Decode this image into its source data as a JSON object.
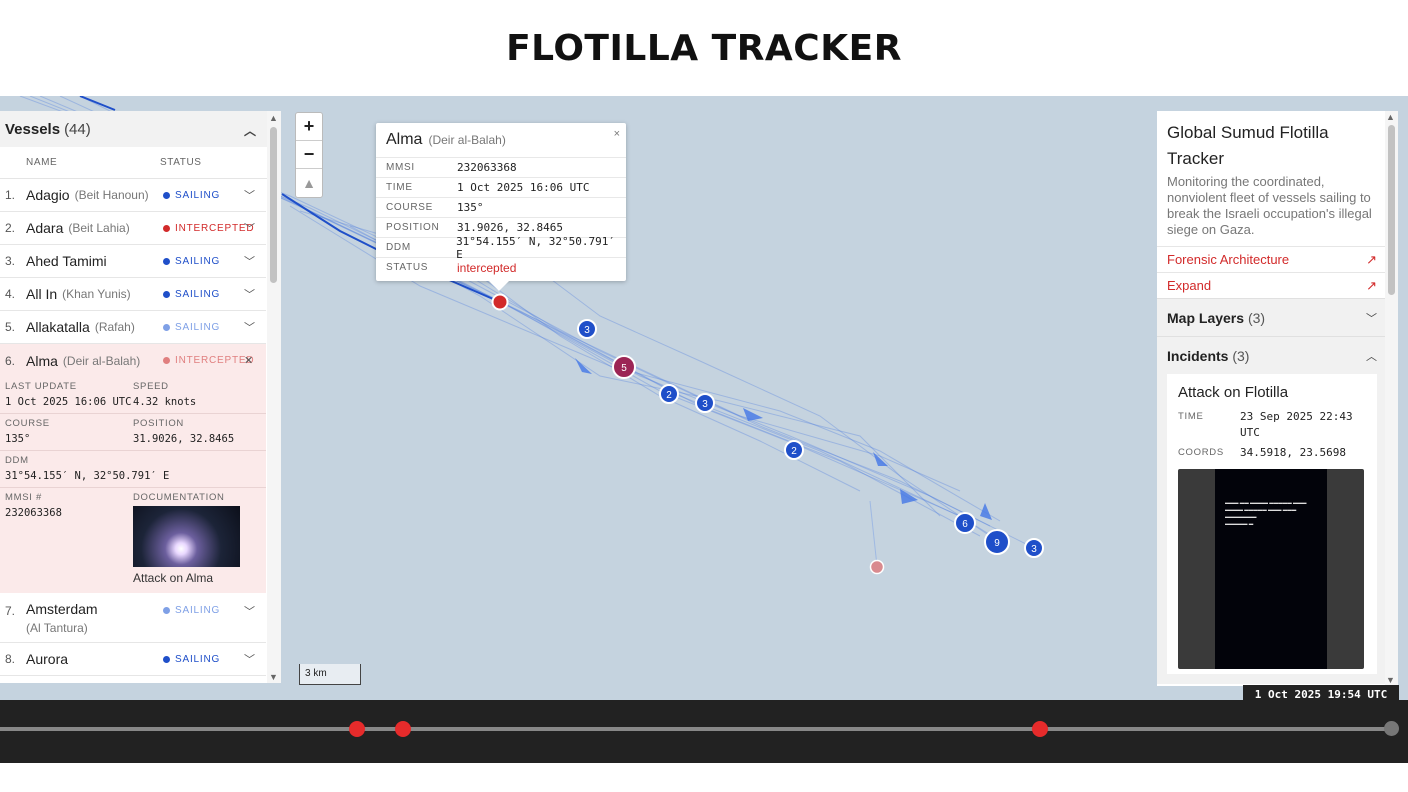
{
  "page_title": "FLOTILLA TRACKER",
  "vessels_panel": {
    "title": "Vessels",
    "count": "(44)",
    "col_name": "NAME",
    "col_status": "STATUS",
    "rows": [
      {
        "num": "1.",
        "name": "Adagio",
        "loc": "(Beit Hanoun)",
        "status": "SAILING"
      },
      {
        "num": "2.",
        "name": "Adara",
        "loc": "(Beit Lahia)",
        "status": "INTERCEPTED"
      },
      {
        "num": "3.",
        "name": "Ahed Tamimi",
        "loc": "",
        "status": "SAILING"
      },
      {
        "num": "4.",
        "name": "All In",
        "loc": "(Khan Yunis)",
        "status": "SAILING"
      },
      {
        "num": "5.",
        "name": "Allakatalla",
        "loc": "(Rafah)",
        "status": "SAILING"
      },
      {
        "num": "6.",
        "name": "Alma",
        "loc": "(Deir al-Balah)",
        "status": "INTERCEPTED"
      },
      {
        "num": "7.",
        "name": "Amsterdam",
        "loc": "(Al Tantura)",
        "status": "SAILING"
      },
      {
        "num": "8.",
        "name": "Aurora",
        "loc": "",
        "status": "SAILING"
      }
    ],
    "detail": {
      "last_update_label": "LAST UPDATE",
      "last_update": "1 Oct 2025 16:06 UTC",
      "speed_label": "SPEED",
      "speed": "4.32 knots",
      "course_label": "COURSE",
      "course": "135°",
      "position_label": "POSITION",
      "position": "31.9026, 32.8465",
      "ddm_label": "DDM",
      "ddm": "31°54.155′ N, 32°50.791′ E",
      "mmsi_label": "MMSI #",
      "mmsi": "232063368",
      "doc_label": "DOCUMENTATION",
      "doc_caption": "Attack on Alma"
    }
  },
  "map": {
    "scale": "3 km",
    "clusters": [
      "3",
      "5",
      "2",
      "3",
      "2",
      "6",
      "9",
      "3"
    ]
  },
  "popup": {
    "name": "Alma",
    "loc": "(Deir al-Balah)",
    "close": "×",
    "rows": [
      {
        "k": "MMSI",
        "v": "232063368"
      },
      {
        "k": "TIME",
        "v": "1 Oct 2025 16:06 UTC"
      },
      {
        "k": "COURSE",
        "v": "135°"
      },
      {
        "k": "POSITION",
        "v": "31.9026, 32.8465"
      },
      {
        "k": "DDM",
        "v": "31°54.155′ N, 32°50.791′ E"
      },
      {
        "k": "STATUS",
        "v": "intercepted"
      }
    ]
  },
  "info_panel": {
    "title": "Global Sumud Flotilla Tracker",
    "desc": "Monitoring the coordinated, nonviolent fleet of vessels sailing to break the Israeli occupation's illegal siege on Gaza.",
    "link1": "Forensic Architecture",
    "link2": "Expand",
    "layers_label": "Map Layers",
    "layers_count": "(3)",
    "incidents_label": "Incidents",
    "incidents_count": "(3)",
    "incident": {
      "title": "Attack on Flotilla",
      "time_label": "TIME",
      "time": "23 Sep 2025 22:43 UTC",
      "coords_label": "COORDS",
      "coords": "34.5918, 23.5698"
    }
  },
  "timeline": {
    "timestamp": "1 Oct 2025 19:54 UTC"
  },
  "colors": {
    "sailing": "#1f4fc9",
    "intercepted": "#d22a2a",
    "map_bg": "#c5d3df",
    "timeline_bg": "#222222"
  }
}
